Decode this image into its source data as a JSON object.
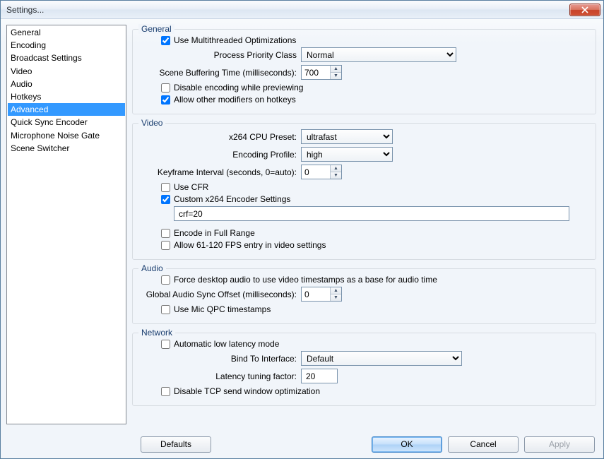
{
  "window": {
    "title": "Settings..."
  },
  "sidebar": {
    "items": [
      {
        "label": "General"
      },
      {
        "label": "Encoding"
      },
      {
        "label": "Broadcast Settings"
      },
      {
        "label": "Video"
      },
      {
        "label": "Audio"
      },
      {
        "label": "Hotkeys"
      },
      {
        "label": "Advanced",
        "selected": true
      },
      {
        "label": "Quick Sync Encoder"
      },
      {
        "label": "Microphone Noise Gate"
      },
      {
        "label": "Scene Switcher"
      }
    ]
  },
  "groups": {
    "general": {
      "legend": "General",
      "multithreaded": "Use Multithreaded Optimizations",
      "priority_label": "Process Priority Class",
      "priority_value": "Normal",
      "buffer_label": "Scene Buffering Time (milliseconds):",
      "buffer_value": "700",
      "disable_preview": "Disable encoding while previewing",
      "allow_modifiers": "Allow other modifiers on hotkeys"
    },
    "video": {
      "legend": "Video",
      "preset_label": "x264 CPU Preset:",
      "preset_value": "ultrafast",
      "profile_label": "Encoding Profile:",
      "profile_value": "high",
      "keyframe_label": "Keyframe Interval (seconds, 0=auto):",
      "keyframe_value": "0",
      "use_cfr": "Use CFR",
      "custom_x264": "Custom x264 Encoder Settings",
      "custom_x264_value": "crf=20",
      "full_range": "Encode in Full Range",
      "allow_fps": "Allow 61-120 FPS entry in video settings"
    },
    "audio": {
      "legend": "Audio",
      "force_ts": "Force desktop audio to use video timestamps as a base for audio time",
      "sync_label": "Global Audio Sync Offset (milliseconds):",
      "sync_value": "0",
      "mic_qpc": "Use Mic QPC timestamps"
    },
    "network": {
      "legend": "Network",
      "auto_low": "Automatic low latency mode",
      "bind_label": "Bind To Interface:",
      "bind_value": "Default",
      "latency_label": "Latency tuning factor:",
      "latency_value": "20",
      "disable_tcp": "Disable TCP send window optimization"
    }
  },
  "footer": {
    "defaults": "Defaults",
    "ok": "OK",
    "cancel": "Cancel",
    "apply": "Apply"
  }
}
